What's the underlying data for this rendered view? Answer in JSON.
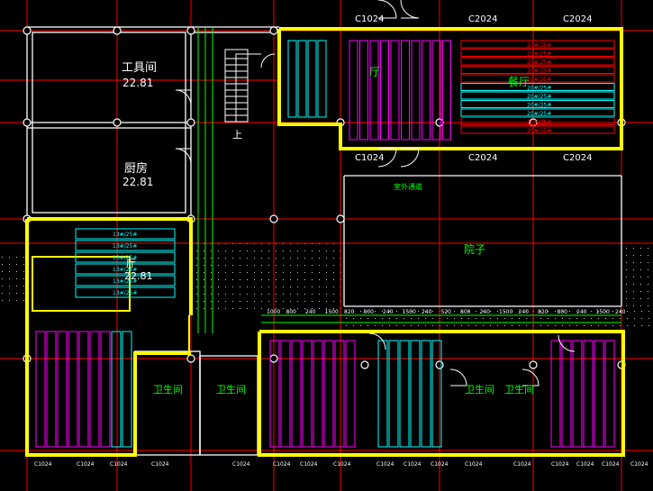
{
  "colors": {
    "background": "#000000",
    "grid_axis": "#ff0000",
    "walls": "#ffffff",
    "highlight": "#ffff00",
    "dimension": "#00ff00",
    "equipment_magenta": "#ff00ff",
    "equipment_cyan": "#00ffff",
    "text_white": "#ffffff",
    "text_green": "#00ff00"
  },
  "rooms": {
    "tool_room": {
      "name": "工具间",
      "area": "22.81"
    },
    "kitchen": {
      "name": "厨房",
      "area": "22.81"
    },
    "hall": {
      "name": "厅"
    },
    "restaurant": {
      "name": "餐厅"
    },
    "courtyard": {
      "name": "院子"
    },
    "courtyard_top_label": "室外通道",
    "bottom_left_room": {
      "name": "厅",
      "area": "22.81"
    },
    "toilets": [
      "卫生间",
      "卫生间",
      "卫生间",
      "卫生间"
    ]
  },
  "window_labels_top": [
    "C1024",
    "C2024",
    "C2024"
  ],
  "window_labels_mid": [
    "C1024",
    "C2024",
    "C2024"
  ],
  "stair_label": "上",
  "equipment_labels": {
    "rack_red": "20#/25#",
    "rack_cyan": "20#/25#",
    "rack_kitchen": "13#/25#"
  },
  "bottom_axis_labels": [
    "C1024",
    "C1024",
    "C1024",
    "C1024",
    "C1024",
    "C1024",
    "C1024",
    "C1024",
    "C1024",
    "C1024",
    "C1024",
    "C1024",
    "C1024",
    "C1024",
    "C1024",
    "C1024",
    "C1024"
  ],
  "row_dimensions": [
    "1000",
    "800",
    "240",
    "1500",
    "820",
    "800",
    "240",
    "1500",
    "240",
    "520",
    "800",
    "240",
    "1500",
    "240",
    "820",
    "800",
    "240",
    "1500",
    "240"
  ]
}
